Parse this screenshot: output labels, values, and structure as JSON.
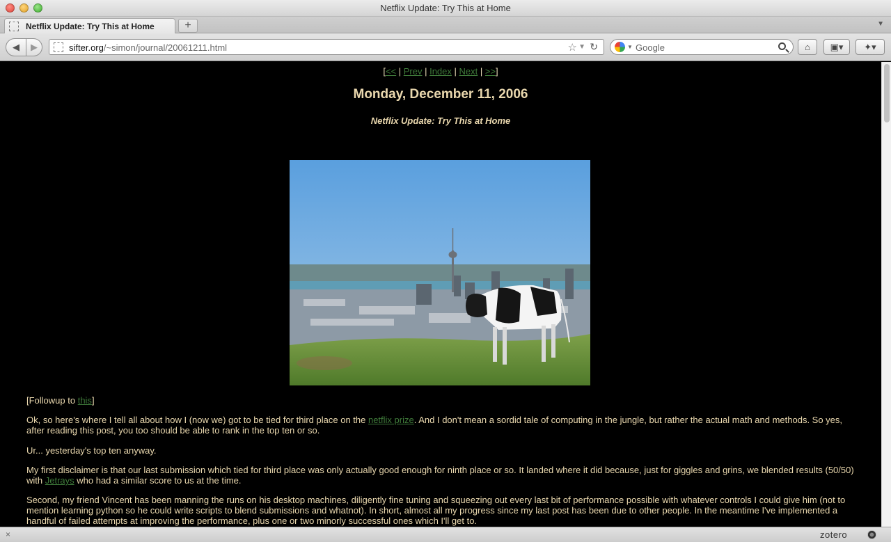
{
  "window": {
    "title": "Netflix Update: Try This at Home"
  },
  "tab": {
    "label": "Netflix Update: Try This at Home",
    "new_tab": "+"
  },
  "toolbar": {
    "back": "◀",
    "forward": "▶",
    "url_host": "sifter.org",
    "url_path": "/~simon/journal/20061211.html",
    "search_placeholder": "Google",
    "star": "☆",
    "reload": "↻",
    "home": "⌂"
  },
  "page": {
    "nav": {
      "first": "<<",
      "prev": "Prev",
      "index": "Index",
      "next": "Next",
      "last": ">>"
    },
    "date": "Monday, December 11, 2006",
    "title": "Netflix Update: Try This at Home",
    "followup": {
      "prefix": "[Followup to ",
      "link": "this",
      "suffix": "]"
    },
    "p2": {
      "before": "Ok, so here's where I tell all about how I (now we) got to be tied for third place on the ",
      "link": "netflix prize",
      "after": ". And I don't mean a sordid tale of computing in the jungle, but rather the actual math and methods. So yes, after reading this post, you too should be able to rank in the top ten or so."
    },
    "p3": "Ur... yesterday's top ten anyway.",
    "p4": {
      "before": "My first disclaimer is that our last submission which tied for third place was only actually good enough for ninth place or so. It landed where it did because, just for giggles and grins, we blended results (50/50) with ",
      "link": "Jetrays",
      "after": " who had a similar score to us at the time."
    },
    "p5": "Second, my friend Vincent has been manning the runs on his desktop machines, diligently fine tuning and squeezing out every last bit of performance possible with whatever controls I could give him (not to mention learning python so he could write scripts to blend submissions and whatnot). In short, almost all my progress since my last post has been due to other people. In the meantime I've implemented a handful of failed attempts at improving the performance, plus one or two minorly successful ones which I'll get to."
  },
  "statusbar": {
    "close": "×",
    "addon": "zotero"
  },
  "colors": {
    "page_bg": "#000000",
    "text": "#ead8ae",
    "link": "#3f7a3a"
  }
}
